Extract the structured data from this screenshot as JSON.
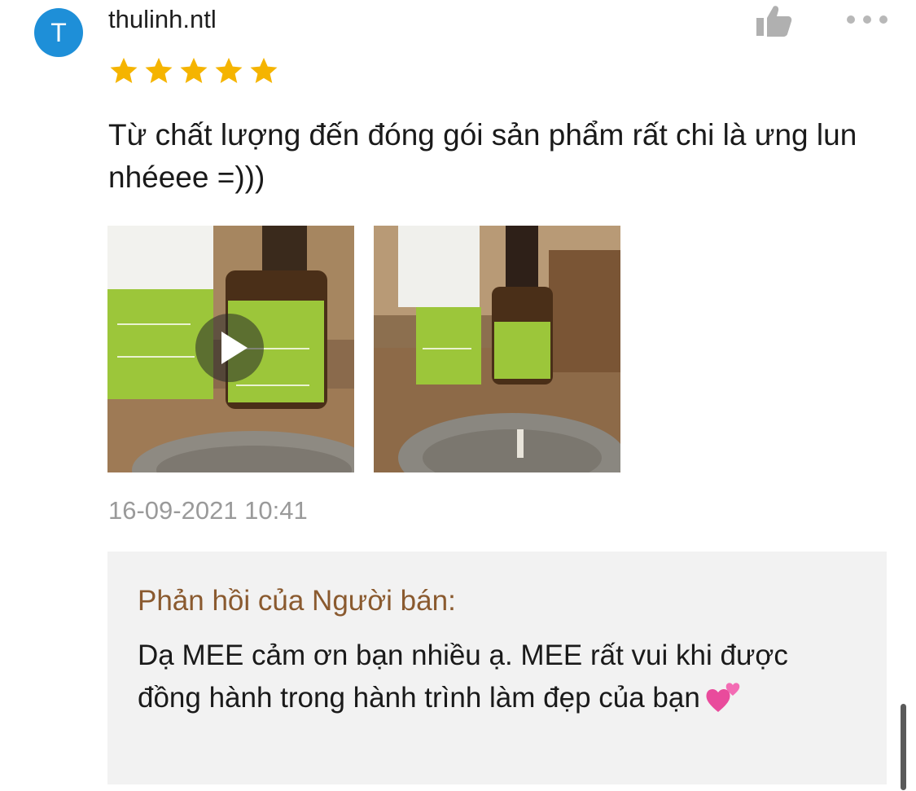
{
  "review": {
    "avatar_letter": "T",
    "username": "thulinh.ntl",
    "rating": 5,
    "text": "Từ chất lượng đến đóng gói sản phẩm rất chi là ưng lun nhéeee =)))",
    "timestamp": "16-09-2021 10:41",
    "icons": {
      "like": "thumbs-up-icon",
      "more": "more-options-icon",
      "star": "star-icon",
      "play": "play-icon"
    },
    "colors": {
      "avatar": "#1e8fd8",
      "star": "#f5b400",
      "product_green": "#9cc63a"
    }
  },
  "seller_reply": {
    "title": "Phản hồi của Người bán:",
    "text": "Dạ MEE cảm ơn bạn nhiều ạ. MEE rất vui khi được đồng hành trong hành trình làm đẹp của bạn",
    "emoji_icon": "two-hearts-icon",
    "colors": {
      "title": "#8a5a2f",
      "background": "#f2f2f2"
    }
  }
}
